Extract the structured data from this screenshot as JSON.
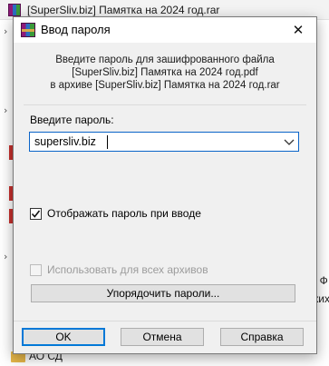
{
  "background": {
    "title": "[SuperSliv.biz] Памятка на 2024 год.rar",
    "right_fragments": [
      ". Ф",
      "ких"
    ],
    "bottom_item": "АО СД"
  },
  "dialog": {
    "title": "Ввод пароля",
    "info_lines": [
      "Введите пароль для зашифрованного файла",
      "[SuperSliv.biz] Памятка на 2024 год.pdf",
      "в архиве [SuperSliv.biz] Памятка на 2024 год.rar"
    ],
    "password_label": "Введите пароль:",
    "password_value": "supersliv.biz",
    "show_password": {
      "label": "Отображать пароль при вводе",
      "checked": true
    },
    "use_for_all": {
      "label": "Использовать для всех архивов",
      "checked": false,
      "disabled": true
    },
    "organize_button": "Упорядочить пароли...",
    "buttons": {
      "ok": "OK",
      "cancel": "Отмена",
      "help": "Справка"
    }
  },
  "icons": {
    "rar": "winrar-archive-icon",
    "close": "close-icon",
    "dropdown": "chevron-down-icon",
    "check": "checkmark-icon",
    "folder": "folder-icon"
  },
  "colors": {
    "focus_border": "#0a64c8",
    "default_button_border": "#0078d7",
    "dialog_bg": "#f0f0f0",
    "disabled_text": "#9c9c9c"
  }
}
